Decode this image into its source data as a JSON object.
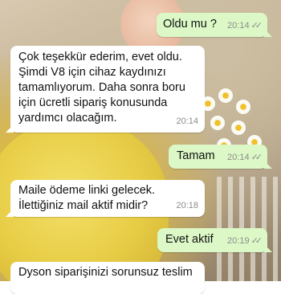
{
  "chat": {
    "messages": [
      {
        "direction": "out",
        "text": "Oldu mu ?",
        "time": "20:14",
        "status": "read"
      },
      {
        "direction": "in",
        "text": "Çok teşekkür ederim, evet oldu.\nŞimdi V8 için cihaz kaydınızı\ntamamlıyorum. Daha sonra boru\niçin ücretli sipariş konusunda\nyardımcı olacağım.",
        "time": "20:14"
      },
      {
        "direction": "out",
        "text": "Tamam",
        "time": "20:14",
        "status": "read"
      },
      {
        "direction": "in",
        "text": "Maile ödeme linki gelecek.\nİlettiğiniz mail aktif midir?",
        "time": "20:18"
      },
      {
        "direction": "out",
        "text": "Evet aktif",
        "time": "20:19",
        "status": "read"
      },
      {
        "direction": "in",
        "text": "Dyson siparişinizi sorunsuz teslim",
        "time": ""
      }
    ],
    "read_ticks": "✓✓",
    "colors": {
      "incoming": "#ffffff",
      "outgoing": "#dcf8c6",
      "meta": "#8c8c8c"
    }
  }
}
